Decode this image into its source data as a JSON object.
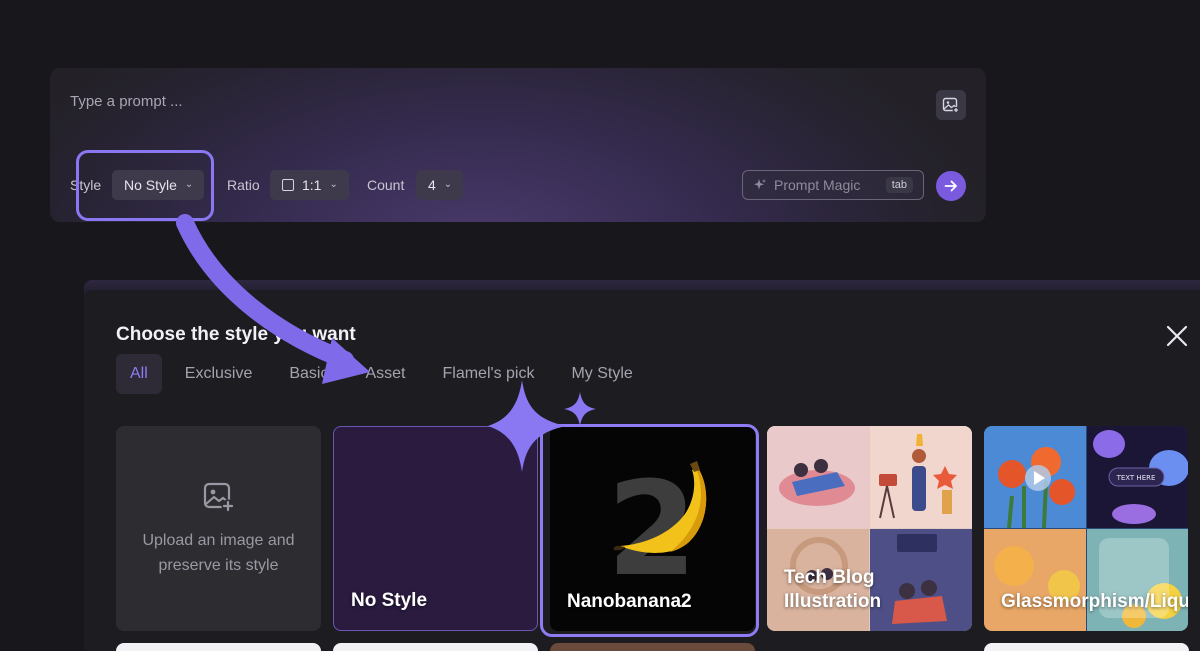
{
  "prompt": {
    "placeholder": "Type a prompt ...",
    "style_label": "Style",
    "style_value": "No Style",
    "ratio_label": "Ratio",
    "ratio_value": "1:1",
    "count_label": "Count",
    "count_value": "4",
    "magic_label": "Prompt Magic",
    "magic_key": "tab"
  },
  "chooser": {
    "title": "Choose the style you want",
    "tabs": [
      "All",
      "Exclusive",
      "Basic",
      "Asset",
      "Flamel's pick",
      "My Style"
    ],
    "active_tab": "All",
    "cards": [
      {
        "title": "Upload an image and preserve its style"
      },
      {
        "title": "No Style"
      },
      {
        "title": "Nanobanana2"
      },
      {
        "title": "Tech Blog Illustration"
      },
      {
        "title": "Glassmorphism/Liquid UI"
      }
    ]
  },
  "nano_thumb_text": "2",
  "glass_thumb_text": "TEXT HERE",
  "colors": {
    "accent": "#7a5be0",
    "highlight": "#8a78f2",
    "background": "#18181c"
  }
}
